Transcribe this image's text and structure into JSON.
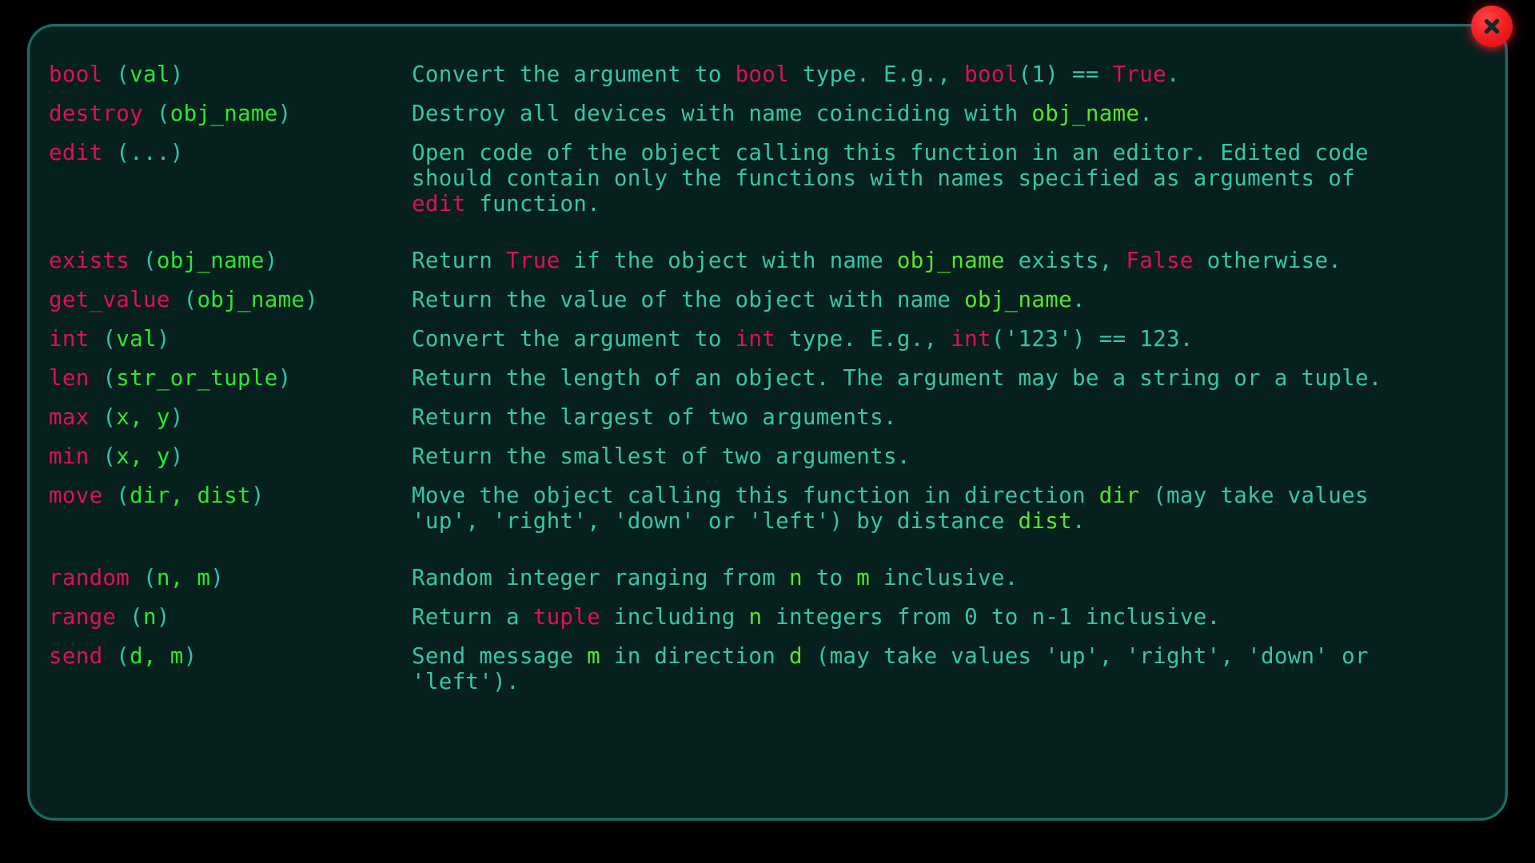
{
  "window": {
    "background_color": "#010101",
    "panel_background_color": "#05201d",
    "panel_border_color": "#1d6b68"
  },
  "colors": {
    "function_name": "#e01055",
    "parenthesis": "#2fc5a8",
    "argument": "#2ae832",
    "description_text": "#35c7a9",
    "keyword": "#e01055",
    "parameter_in_text": "#57e62b",
    "close_button": "#f42020"
  },
  "close_button": {
    "icon": "close-icon",
    "label": "×"
  },
  "help": {
    "entries": [
      {
        "name": "bool",
        "signature_parts": [
          {
            "t": "bool",
            "c": "fn"
          },
          {
            "t": " (",
            "c": "paren"
          },
          {
            "t": "val",
            "c": "arg"
          },
          {
            "t": ")",
            "c": "paren"
          }
        ],
        "signature_plain": "bool (val)",
        "description_plain": "Convert the argument to bool type. E.g., bool(1) == True.",
        "description_lines": [
          [
            {
              "t": "Convert the argument to ",
              "c": "txt"
            },
            {
              "t": "bool",
              "c": "kw"
            },
            {
              "t": " type. E.g., ",
              "c": "txt"
            },
            {
              "t": "bool",
              "c": "kw"
            },
            {
              "t": "(1) == ",
              "c": "txt"
            },
            {
              "t": "True",
              "c": "kw"
            },
            {
              "t": ".",
              "c": "txt"
            }
          ]
        ],
        "gap_after": false
      },
      {
        "name": "destroy",
        "signature_parts": [
          {
            "t": "destroy",
            "c": "fn"
          },
          {
            "t": " (",
            "c": "paren"
          },
          {
            "t": "obj_name",
            "c": "arg"
          },
          {
            "t": ")",
            "c": "paren"
          }
        ],
        "signature_plain": "destroy (obj_name)",
        "description_plain": "Destroy all devices with name coinciding with obj_name.",
        "description_lines": [
          [
            {
              "t": "Destroy all devices with name coinciding with ",
              "c": "txt"
            },
            {
              "t": "obj_name",
              "c": "par"
            },
            {
              "t": ".",
              "c": "txt"
            }
          ]
        ],
        "gap_after": false
      },
      {
        "name": "edit",
        "signature_parts": [
          {
            "t": "edit",
            "c": "fn"
          },
          {
            "t": " (",
            "c": "paren"
          },
          {
            "t": "...",
            "c": "paren"
          },
          {
            "t": ")",
            "c": "paren"
          }
        ],
        "signature_plain": "edit (...)",
        "description_plain": "Open code of the object calling this function in an editor. Edited code should contain only the functions with names specified as arguments of edit function.",
        "description_lines": [
          [
            {
              "t": "Open code of the object calling this function in an editor. Edited code",
              "c": "txt"
            }
          ],
          [
            {
              "t": "should contain only the functions with names specified as arguments of",
              "c": "txt"
            }
          ],
          [
            {
              "t": "edit",
              "c": "kw"
            },
            {
              "t": " function.",
              "c": "txt"
            }
          ]
        ],
        "gap_after": true
      },
      {
        "name": "exists",
        "signature_parts": [
          {
            "t": "exists",
            "c": "fn"
          },
          {
            "t": " (",
            "c": "paren"
          },
          {
            "t": "obj_name",
            "c": "arg"
          },
          {
            "t": ")",
            "c": "paren"
          }
        ],
        "signature_plain": "exists (obj_name)",
        "description_plain": "Return True if the object with name obj_name exists, False otherwise.",
        "description_lines": [
          [
            {
              "t": "Return ",
              "c": "txt"
            },
            {
              "t": "True",
              "c": "kw"
            },
            {
              "t": " if the object with name ",
              "c": "txt"
            },
            {
              "t": "obj_name",
              "c": "par"
            },
            {
              "t": " exists, ",
              "c": "txt"
            },
            {
              "t": "False",
              "c": "kw"
            },
            {
              "t": " otherwise.",
              "c": "txt"
            }
          ]
        ],
        "gap_after": false
      },
      {
        "name": "get_value",
        "signature_parts": [
          {
            "t": "get_value",
            "c": "fn"
          },
          {
            "t": " (",
            "c": "paren"
          },
          {
            "t": "obj_name",
            "c": "arg"
          },
          {
            "t": ")",
            "c": "paren"
          }
        ],
        "signature_plain": "get_value (obj_name)",
        "description_plain": "Return the value of the object with name obj_name.",
        "description_lines": [
          [
            {
              "t": "Return the value of the object with name ",
              "c": "txt"
            },
            {
              "t": "obj_name",
              "c": "par"
            },
            {
              "t": ".",
              "c": "txt"
            }
          ]
        ],
        "gap_after": false
      },
      {
        "name": "int",
        "signature_parts": [
          {
            "t": "int",
            "c": "fn"
          },
          {
            "t": " (",
            "c": "paren"
          },
          {
            "t": "val",
            "c": "arg"
          },
          {
            "t": ")",
            "c": "paren"
          }
        ],
        "signature_plain": "int (val)",
        "description_plain": "Convert the argument to int type. E.g., int('123') == 123.",
        "description_lines": [
          [
            {
              "t": "Convert the argument to ",
              "c": "txt"
            },
            {
              "t": "int",
              "c": "kw"
            },
            {
              "t": " type. E.g., ",
              "c": "txt"
            },
            {
              "t": "int",
              "c": "kw"
            },
            {
              "t": "('123') == 123.",
              "c": "txt"
            }
          ]
        ],
        "gap_after": false
      },
      {
        "name": "len",
        "signature_parts": [
          {
            "t": "len",
            "c": "fn"
          },
          {
            "t": " (",
            "c": "paren"
          },
          {
            "t": "str_or_tuple",
            "c": "arg"
          },
          {
            "t": ")",
            "c": "paren"
          }
        ],
        "signature_plain": "len (str_or_tuple)",
        "description_plain": "Return the length of an object. The argument may be a string or a tuple.",
        "description_lines": [
          [
            {
              "t": "Return the length of an object. The argument may be a string or a tuple.",
              "c": "txt"
            }
          ]
        ],
        "gap_after": false
      },
      {
        "name": "max",
        "signature_parts": [
          {
            "t": "max",
            "c": "fn"
          },
          {
            "t": " (",
            "c": "paren"
          },
          {
            "t": "x, y",
            "c": "arg"
          },
          {
            "t": ")",
            "c": "paren"
          }
        ],
        "signature_plain": "max (x, y)",
        "description_plain": "Return the largest of two arguments.",
        "description_lines": [
          [
            {
              "t": "Return the largest of two arguments.",
              "c": "txt"
            }
          ]
        ],
        "gap_after": false
      },
      {
        "name": "min",
        "signature_parts": [
          {
            "t": "min",
            "c": "fn"
          },
          {
            "t": " (",
            "c": "paren"
          },
          {
            "t": "x, y",
            "c": "arg"
          },
          {
            "t": ")",
            "c": "paren"
          }
        ],
        "signature_plain": "min (x, y)",
        "description_plain": "Return the smallest of two arguments.",
        "description_lines": [
          [
            {
              "t": "Return the smallest of two arguments.",
              "c": "txt"
            }
          ]
        ],
        "gap_after": false
      },
      {
        "name": "move",
        "signature_parts": [
          {
            "t": "move",
            "c": "fn"
          },
          {
            "t": " (",
            "c": "paren"
          },
          {
            "t": "dir, dist",
            "c": "arg"
          },
          {
            "t": ")",
            "c": "paren"
          }
        ],
        "signature_plain": "move (dir, dist)",
        "description_plain": "Move the object calling this function in direction dir (may take values 'up', 'right', 'down' or 'left') by distance dist.",
        "description_lines": [
          [
            {
              "t": "Move the object calling this function in direction ",
              "c": "txt"
            },
            {
              "t": "dir",
              "c": "par"
            },
            {
              "t": " (may take values",
              "c": "txt"
            }
          ],
          [
            {
              "t": "'up', 'right', 'down' or 'left') by distance ",
              "c": "txt"
            },
            {
              "t": "dist",
              "c": "par"
            },
            {
              "t": ".",
              "c": "txt"
            }
          ]
        ],
        "gap_after": true
      },
      {
        "name": "random",
        "signature_parts": [
          {
            "t": "random",
            "c": "fn"
          },
          {
            "t": " (",
            "c": "paren"
          },
          {
            "t": "n, m",
            "c": "arg"
          },
          {
            "t": ")",
            "c": "paren"
          }
        ],
        "signature_plain": "random (n, m)",
        "description_plain": "Random integer ranging from n to m inclusive.",
        "description_lines": [
          [
            {
              "t": "Random integer ranging from ",
              "c": "txt"
            },
            {
              "t": "n",
              "c": "par"
            },
            {
              "t": " to ",
              "c": "txt"
            },
            {
              "t": "m",
              "c": "par"
            },
            {
              "t": " inclusive.",
              "c": "txt"
            }
          ]
        ],
        "gap_after": false
      },
      {
        "name": "range",
        "signature_parts": [
          {
            "t": "range",
            "c": "fn"
          },
          {
            "t": " (",
            "c": "paren"
          },
          {
            "t": "n",
            "c": "arg"
          },
          {
            "t": ")",
            "c": "paren"
          }
        ],
        "signature_plain": "range (n)",
        "description_plain": "Return a tuple including n integers from 0 to n-1 inclusive.",
        "description_lines": [
          [
            {
              "t": "Return a ",
              "c": "txt"
            },
            {
              "t": "tuple",
              "c": "kw"
            },
            {
              "t": " including ",
              "c": "txt"
            },
            {
              "t": "n",
              "c": "par"
            },
            {
              "t": " integers from 0 to ",
              "c": "txt"
            },
            {
              "t": "n-1",
              "c": "txt"
            },
            {
              "t": " inclusive.",
              "c": "txt"
            }
          ]
        ],
        "gap_after": false
      },
      {
        "name": "send",
        "signature_parts": [
          {
            "t": "send",
            "c": "fn"
          },
          {
            "t": " (",
            "c": "paren"
          },
          {
            "t": "d, m",
            "c": "arg"
          },
          {
            "t": ")",
            "c": "paren"
          }
        ],
        "signature_plain": "send (d, m)",
        "description_plain": "Send message m in direction d (may take values 'up', 'right', 'down' or 'left').",
        "description_lines": [
          [
            {
              "t": "Send message ",
              "c": "txt"
            },
            {
              "t": "m",
              "c": "par"
            },
            {
              "t": " in direction ",
              "c": "txt"
            },
            {
              "t": "d",
              "c": "par"
            },
            {
              "t": " (may take values 'up', 'right', 'down' or",
              "c": "txt"
            }
          ],
          [
            {
              "t": "'left').",
              "c": "txt"
            }
          ]
        ],
        "gap_after": false
      }
    ]
  }
}
